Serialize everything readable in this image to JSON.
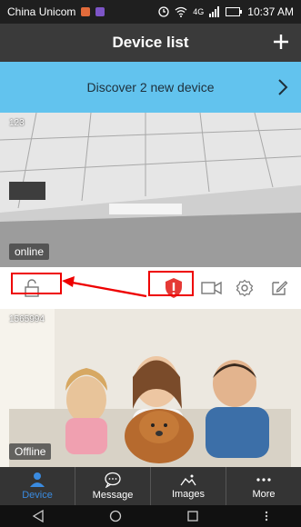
{
  "status_bar": {
    "carrier": "China Unicom",
    "network": "4G",
    "time": "10:37 AM"
  },
  "header": {
    "title": "Device list",
    "add_icon": "plus-icon"
  },
  "discover_banner": {
    "text": "Discover  2  new device"
  },
  "devices": [
    {
      "name": "123",
      "status": "online"
    },
    {
      "name": "1565994",
      "status": "Offline"
    }
  ],
  "action_bar": {
    "icons": [
      "unlock-icon",
      "alert-shield-icon",
      "video-icon",
      "settings-icon",
      "edit-icon"
    ]
  },
  "tabs": [
    {
      "label": "Device",
      "icon": "person-icon",
      "active": true
    },
    {
      "label": "Message",
      "icon": "chat-icon",
      "active": false
    },
    {
      "label": "Images",
      "icon": "image-icon",
      "active": false
    },
    {
      "label": "More",
      "icon": "more-icon",
      "active": false
    }
  ],
  "colors": {
    "accent_blue": "#3a8be0",
    "banner": "#62c3ee",
    "alert_red": "#e53935"
  }
}
